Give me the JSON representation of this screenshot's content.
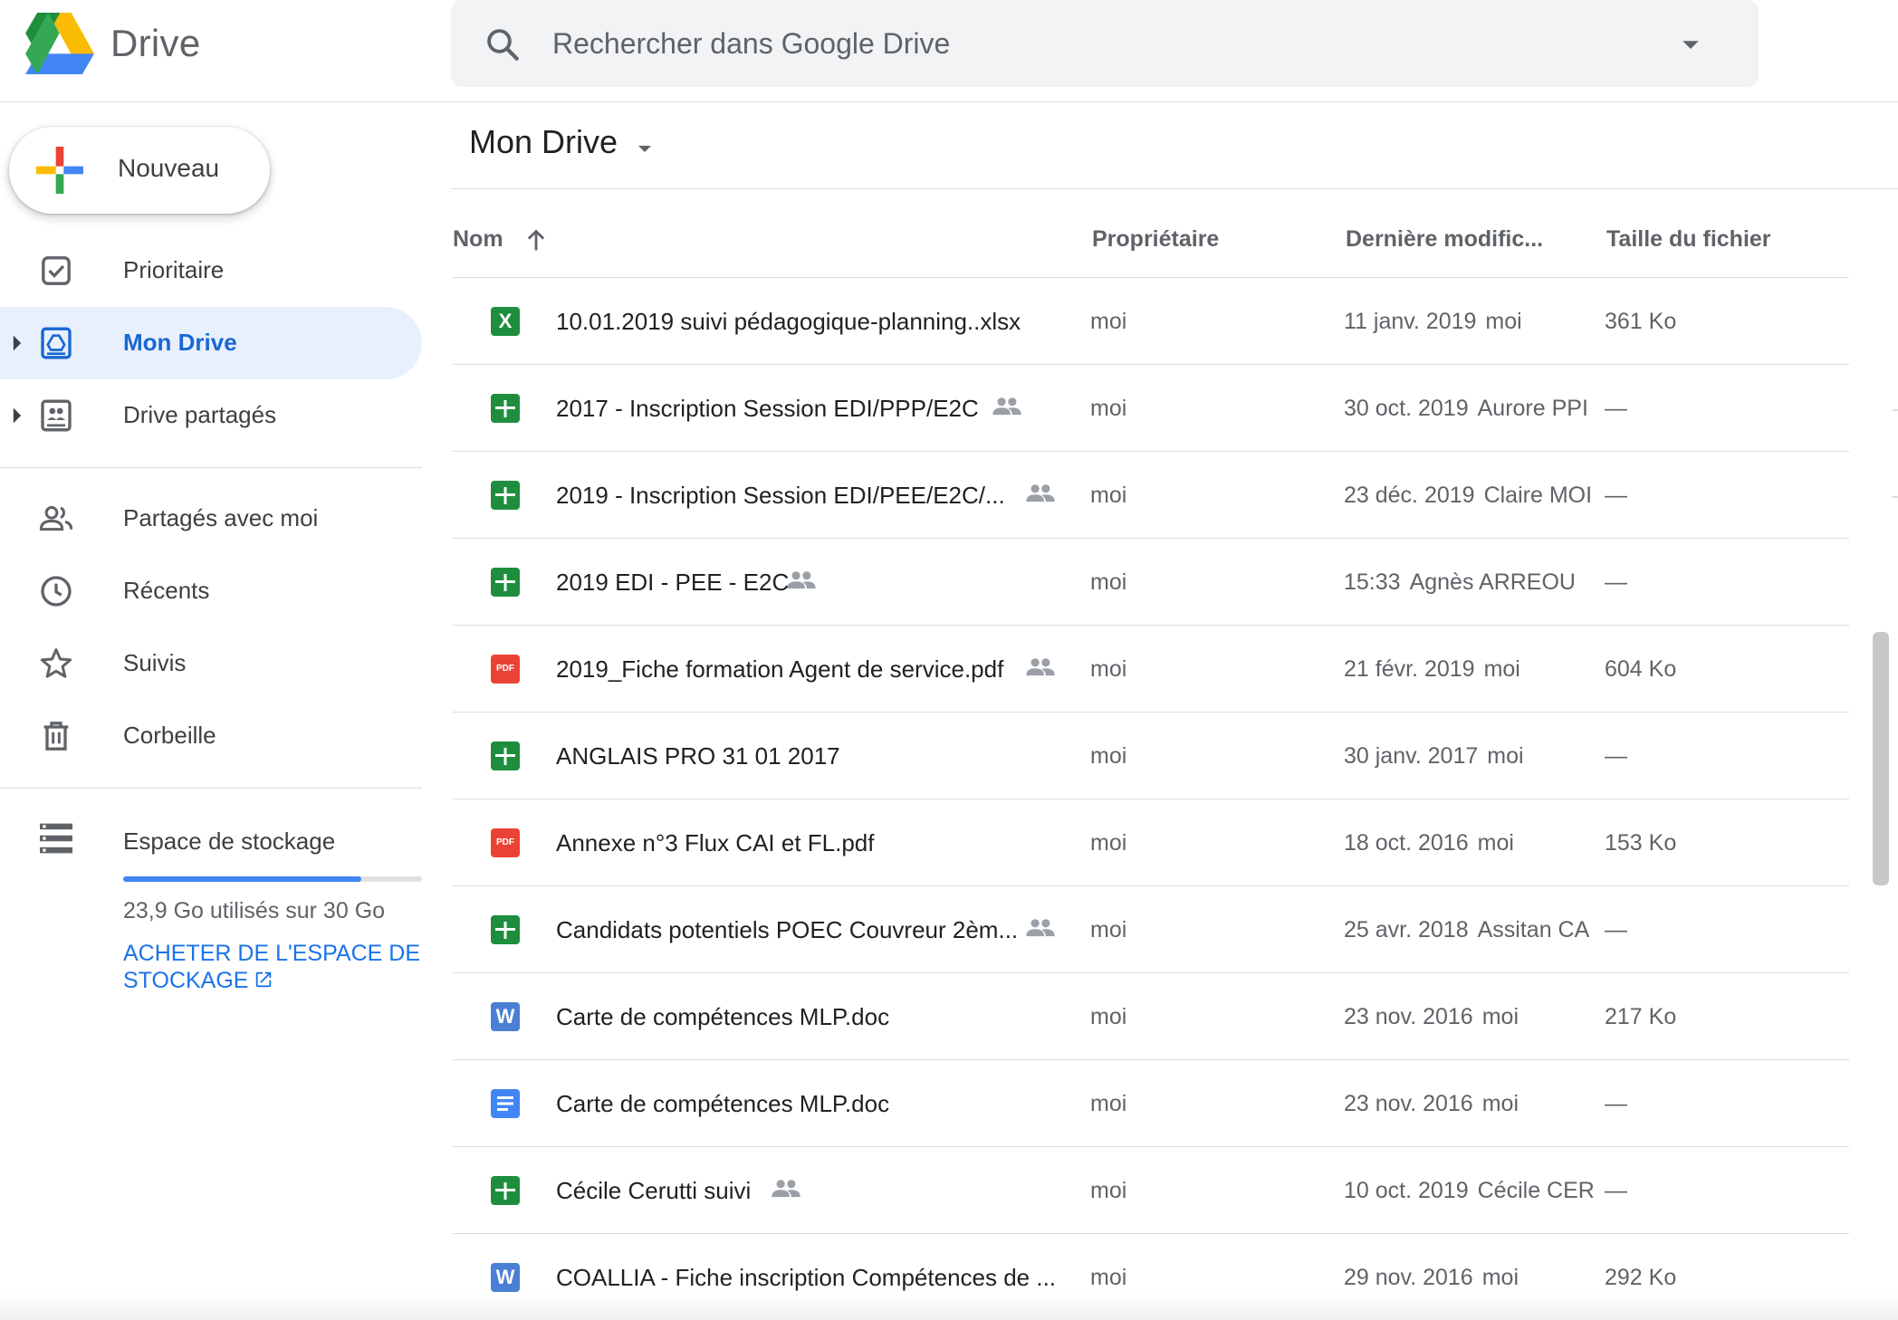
{
  "app": {
    "name": "Drive"
  },
  "search": {
    "placeholder": "Rechercher dans Google Drive"
  },
  "sidebar": {
    "new_label": "Nouveau",
    "items": [
      {
        "label": "Prioritaire",
        "icon": "priority-check-icon",
        "active": false,
        "expandable": false
      },
      {
        "label": "Mon Drive",
        "icon": "my-drive-icon",
        "active": true,
        "expandable": true
      },
      {
        "label": "Drive partagés",
        "icon": "shared-drives-icon",
        "active": false,
        "expandable": true
      },
      {
        "label": "Partagés avec moi",
        "icon": "people-icon",
        "active": false,
        "expandable": false
      },
      {
        "label": "Récents",
        "icon": "clock-icon",
        "active": false,
        "expandable": false
      },
      {
        "label": "Suivis",
        "icon": "star-icon",
        "active": false,
        "expandable": false
      },
      {
        "label": "Corbeille",
        "icon": "trash-icon",
        "active": false,
        "expandable": false
      }
    ],
    "storage": {
      "label": "Espace de stockage",
      "usage_text": "23,9 Go utilisés sur 30 Go",
      "used_fraction": 0.797,
      "buy_label": "ACHETER DE L'ESPACE DE STOCKAGE"
    }
  },
  "main": {
    "title": "Mon Drive",
    "columns": {
      "name": "Nom",
      "owner": "Propriétaire",
      "modified": "Dernière modific...",
      "size": "Taille du fichier"
    },
    "sort": "name-ascending",
    "files": [
      {
        "name": "10.01.2019 suivi pédagogique-planning..xlsx",
        "type": "excel",
        "shared": false,
        "owner": "moi",
        "modified": "11 janv. 2019",
        "modified_by": "moi",
        "size": "361 Ko"
      },
      {
        "name": "2017 - Inscription Session EDI/PPP/E2C",
        "type": "sheets",
        "shared": true,
        "owner": "moi",
        "modified": "30 oct. 2019",
        "modified_by": "Aurore PPI",
        "size": "—"
      },
      {
        "name": "2019 - Inscription Session EDI/PEE/E2C/...",
        "type": "sheets",
        "shared": true,
        "owner": "moi",
        "modified": "23 déc. 2019",
        "modified_by": "Claire MOI",
        "size": "—"
      },
      {
        "name": "2019 EDI - PEE - E2C",
        "type": "sheets",
        "shared": true,
        "owner": "moi",
        "modified": "15:33",
        "modified_by": "Agnès ARREOU",
        "size": "—"
      },
      {
        "name": "2019_Fiche formation Agent de service.pdf",
        "type": "pdf",
        "shared": true,
        "owner": "moi",
        "modified": "21 févr. 2019",
        "modified_by": "moi",
        "size": "604 Ko"
      },
      {
        "name": "ANGLAIS PRO 31 01 2017",
        "type": "sheets",
        "shared": false,
        "owner": "moi",
        "modified": "30 janv. 2017",
        "modified_by": "moi",
        "size": "—"
      },
      {
        "name": "Annexe n°3 Flux CAI et FL.pdf",
        "type": "pdf",
        "shared": false,
        "owner": "moi",
        "modified": "18 oct. 2016",
        "modified_by": "moi",
        "size": "153 Ko"
      },
      {
        "name": "Candidats potentiels POEC Couvreur 2èm...",
        "type": "sheets",
        "shared": true,
        "owner": "moi",
        "modified": "25 avr. 2018",
        "modified_by": "Assitan CA",
        "size": "—"
      },
      {
        "name": "Carte de compétences MLP.doc",
        "type": "word",
        "shared": false,
        "owner": "moi",
        "modified": "23 nov. 2016",
        "modified_by": "moi",
        "size": "217 Ko"
      },
      {
        "name": "Carte de compétences MLP.doc",
        "type": "docs",
        "shared": false,
        "owner": "moi",
        "modified": "23 nov. 2016",
        "modified_by": "moi",
        "size": "—"
      },
      {
        "name": "Cécile Cerutti suivi",
        "type": "sheets",
        "shared": true,
        "owner": "moi",
        "modified": "10 oct. 2019",
        "modified_by": "Cécile CER",
        "size": "—"
      },
      {
        "name": "COALLIA - Fiche inscription Compétences de ...",
        "type": "word",
        "shared": false,
        "owner": "moi",
        "modified": "29 nov. 2016",
        "modified_by": "moi",
        "size": "292 Ko"
      }
    ]
  },
  "icons": {
    "excel": {
      "glyph": "X",
      "color": "#1e8e3e"
    },
    "sheets": {
      "glyph": "",
      "color": "#1e8e3e"
    },
    "pdf": {
      "glyph": "PDF",
      "color": "#ea4335"
    },
    "word": {
      "glyph": "W",
      "color": "#4a7fd4"
    },
    "docs": {
      "glyph": "",
      "color": "#4285f4"
    }
  },
  "colors": {
    "accent": "#1a73e8",
    "active_bg": "#e8f0fe",
    "active_text": "#1967d2"
  }
}
